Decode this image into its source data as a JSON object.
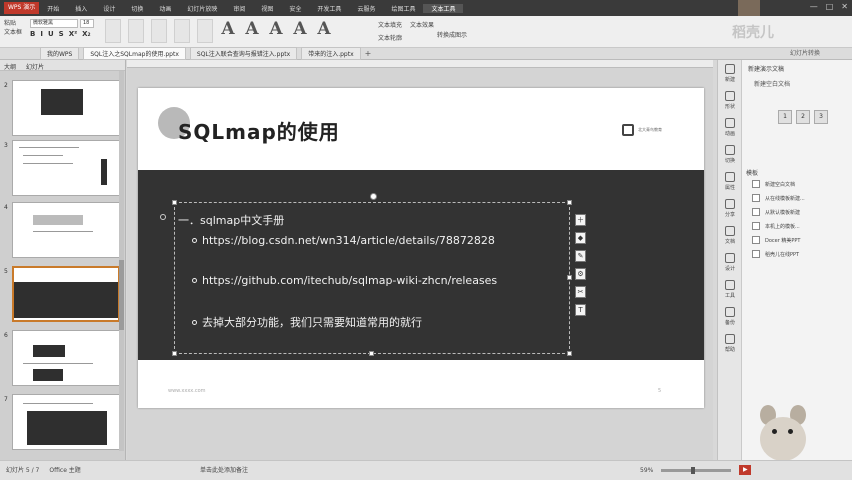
{
  "titlebar": {
    "app_badge": "WPS 演示",
    "menu_tabs": [
      "开始",
      "插入",
      "设计",
      "切换",
      "动画",
      "幻灯片放映",
      "审阅",
      "视图",
      "安全",
      "开发工具",
      "云服务",
      "绘图工具",
      "文本工具"
    ],
    "active_tab_index": 12,
    "window_controls": [
      "—",
      "□",
      "✕"
    ]
  },
  "ribbon": {
    "left_labels": [
      "粘贴",
      "文本框"
    ],
    "font_name": "微软雅黑",
    "font_size": "18",
    "format_tools": [
      "B",
      "I",
      "U",
      "S",
      "X²",
      "X₂"
    ],
    "style_glyphs": [
      "A",
      "A",
      "A",
      "A",
      "A"
    ],
    "right_col1": [
      "文本填充",
      "文本轮廓"
    ],
    "right_col2": [
      "文本效果"
    ],
    "right_col3": "转换成图示"
  },
  "doc_tabs": [
    {
      "label": "我的WPS",
      "active": false
    },
    {
      "label": "SQL注入之SQLmap的使用.pptx",
      "active": true
    },
    {
      "label": "SQL注入联合查询与报错注入.pptx",
      "active": false
    },
    {
      "label": "带来的注入.pptx",
      "active": false
    }
  ],
  "left_panel": {
    "tabs": [
      "大纲",
      "幻灯片"
    ],
    "thumb_numbers": [
      "2",
      "3",
      "4",
      "5",
      "6",
      "7"
    ]
  },
  "slide": {
    "title": "SQLmap的使用",
    "logo_text": "北大青鸟教育",
    "heading": "一．sqlmap中文手册",
    "bullets": [
      "https://blog.csdn.net/wn314/article/details/78872828",
      "https://github.com/itechub/sqlmap-wiki-zhcn/releases",
      "去掉大部分功能，我们只需要知道常用的就行"
    ],
    "side_icons": [
      "＋",
      "◆",
      "✎",
      "⚙",
      "✂",
      "T"
    ],
    "footer": "www.xxxx.com",
    "page_number": "5"
  },
  "right_toolbar": [
    "新建",
    "形状",
    "动画",
    "切换",
    "属性",
    "分享",
    "文档",
    "设计",
    "工具",
    "备份",
    "帮助"
  ],
  "right_pane": {
    "title": "新建演示文稿",
    "subtitle": "新建空白文档",
    "buttons": [
      "1",
      "2",
      "3"
    ],
    "section": "模板",
    "items": [
      "新建空白文档",
      "从在线模板新建...",
      "从默认模板新建",
      "本机上的模板...",
      "Docer 精美PPT",
      "稻壳儿在线PPT"
    ]
  },
  "watermark": {
    "main": "稻壳儿",
    "small": "幻灯片转换"
  },
  "statusbar": {
    "left": [
      "幻灯片 5 / 7",
      "Office 主题"
    ],
    "mid": "单击此处添加备注",
    "zoom": "59%"
  }
}
